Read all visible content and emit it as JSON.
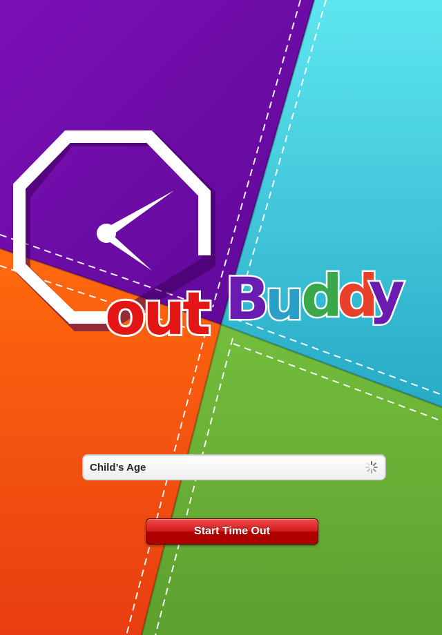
{
  "app": {
    "logo_prefix": "out",
    "logo_letters": [
      "B",
      "u",
      "d",
      "d",
      "y"
    ]
  },
  "form": {
    "age_label": "Child’s Age",
    "start_label": "Start Time Out"
  },
  "colors": {
    "purple": "#6c0aa4",
    "cyan": "#42c9da",
    "orange": "#f1540f",
    "green": "#6db43b",
    "logo_red": "#e41515",
    "logo_letter_colors": [
      "#6a1bb0",
      "#2aa0c9",
      "#3aa84a",
      "#e8402a",
      "#6a1bb0"
    ]
  },
  "icons": {
    "clock": "octagon-clock-icon",
    "spinner": "spinner-icon"
  }
}
